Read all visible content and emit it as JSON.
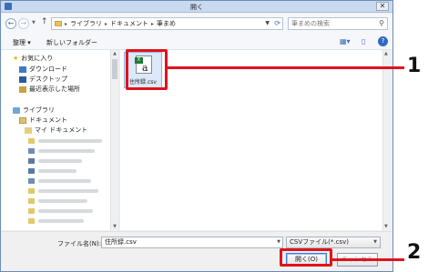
{
  "window": {
    "title": "開く",
    "close_glyph": "✕"
  },
  "addressbar": {
    "back_glyph": "←",
    "forward_glyph": "→",
    "up_glyph": "↑",
    "breadcrumb": [
      "ライブラリ",
      "ドキュメント",
      "筆まめ"
    ],
    "search_placeholder": "筆まめの検索"
  },
  "toolbar": {
    "organize_label": "整理 ▾",
    "new_folder_label": "新しいフォルダー"
  },
  "navpane": {
    "favorites_label": "お気に入り",
    "favorites": [
      "ダウンロード",
      "デスクトップ",
      "最近表示した場所"
    ],
    "libraries_label": "ライブラリ",
    "documents_label": "ドキュメント",
    "my_documents_label": "マイ ドキュメント"
  },
  "files": [
    {
      "name": "住所録.csv",
      "icon": "csv-excel-icon"
    }
  ],
  "bottom": {
    "filename_label": "ファイル名(N):",
    "filename_value": "住所録.csv",
    "filter_value": "CSVファイル(*.csv)",
    "open_label": "開く(O)",
    "cancel_label": "キャンセル"
  },
  "callouts": [
    "1",
    "2"
  ],
  "colors": {
    "highlight": "#e0131c",
    "accent": "#3a6ebc"
  }
}
